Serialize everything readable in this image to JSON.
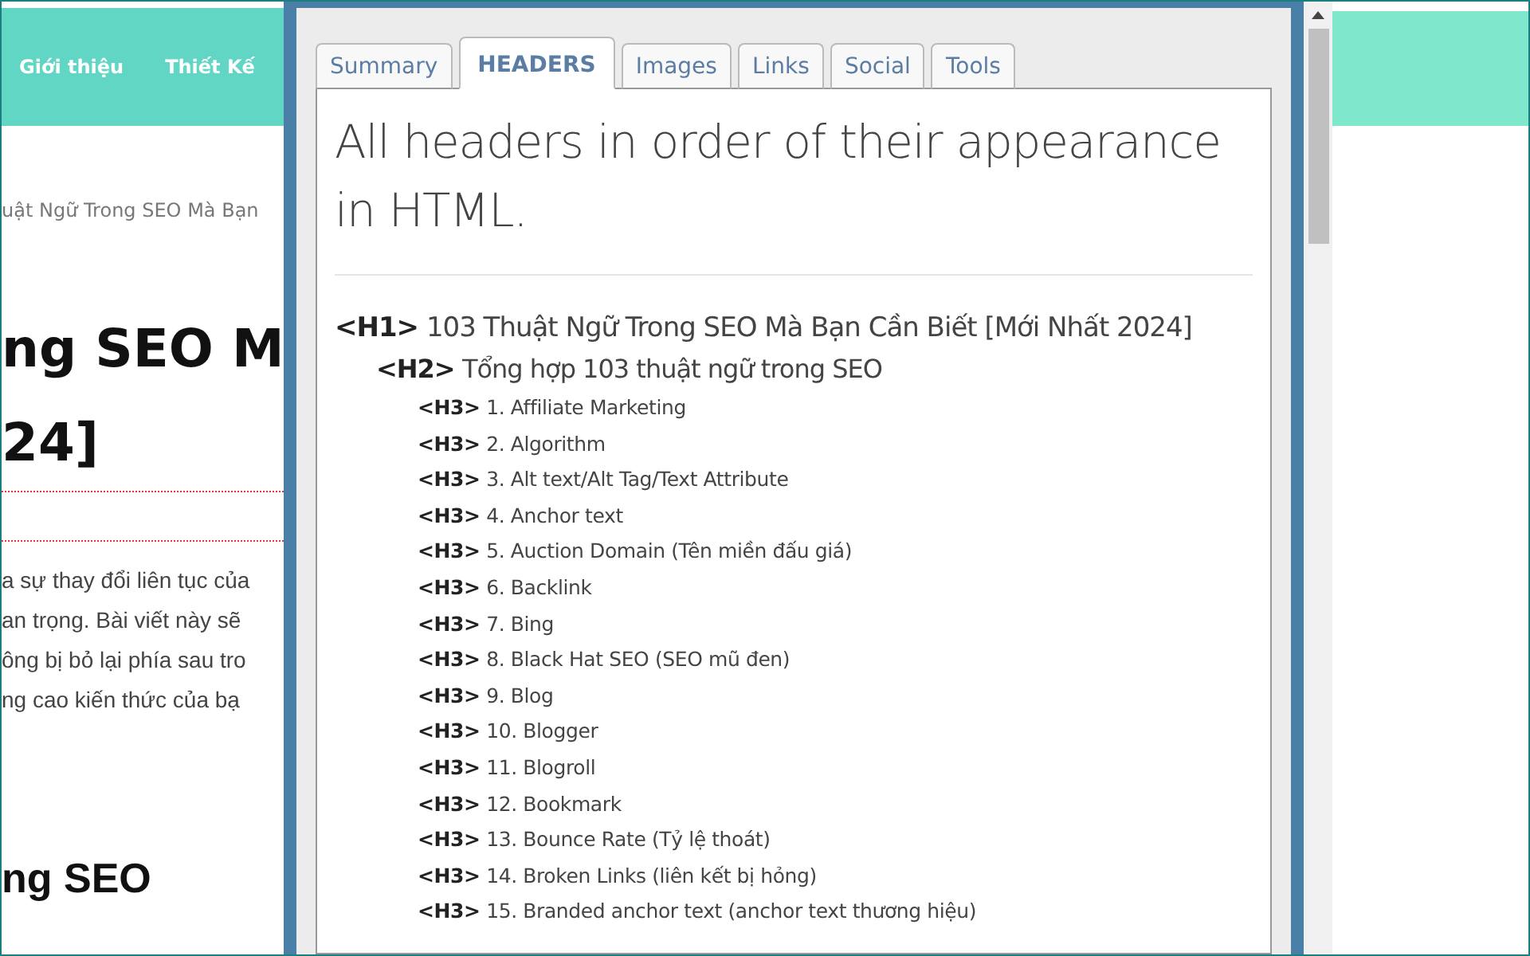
{
  "page": {
    "nav": [
      {
        "label": "Giới thiệu"
      },
      {
        "label": "Thiết Kế"
      }
    ],
    "breadcrumb": "uật Ngữ Trong SEO Mà Bạn",
    "title_lines": [
      "ng SEO M",
      "24]"
    ],
    "paragraph_lines": [
      "a sự thay đổi liên tục của",
      "an trọng. Bài viết này sẽ",
      "ông bị bỏ lại phía sau tro",
      "ng cao kiến thức của bạ"
    ],
    "subheading": "ng SEO"
  },
  "popup": {
    "tabs": [
      {
        "label": "Summary",
        "selected": false
      },
      {
        "label": "HEADERS",
        "selected": true
      },
      {
        "label": "Images",
        "selected": false
      },
      {
        "label": "Links",
        "selected": false
      },
      {
        "label": "Social",
        "selected": false
      },
      {
        "label": "Tools",
        "selected": false
      }
    ],
    "heading": "All headers in order of their appearance in HTML.",
    "headers": [
      {
        "tag": "<H1>",
        "text": "103 Thuật Ngữ Trong SEO Mà Bạn Cần Biết [Mới Nhất 2024]",
        "children": [
          {
            "tag": "<H2>",
            "text": "Tổng hợp 103 thuật ngữ trong SEO",
            "children": [
              {
                "tag": "<H3>",
                "text": "1. Affiliate Marketing"
              },
              {
                "tag": "<H3>",
                "text": "2. Algorithm"
              },
              {
                "tag": "<H3>",
                "text": "3. Alt text/Alt Tag/Text Attribute"
              },
              {
                "tag": "<H3>",
                "text": "4. Anchor text"
              },
              {
                "tag": "<H3>",
                "text": "5. Auction Domain (Tên miền đấu giá)"
              },
              {
                "tag": "<H3>",
                "text": "6. Backlink"
              },
              {
                "tag": "<H3>",
                "text": "7. Bing"
              },
              {
                "tag": "<H3>",
                "text": "8. Black Hat SEO (SEO mũ đen)"
              },
              {
                "tag": "<H3>",
                "text": "9. Blog"
              },
              {
                "tag": "<H3>",
                "text": "10. Blogger"
              },
              {
                "tag": "<H3>",
                "text": "11. Blogroll"
              },
              {
                "tag": "<H3>",
                "text": "12. Bookmark"
              },
              {
                "tag": "<H3>",
                "text": "13. Bounce Rate (Tỷ lệ thoát)"
              },
              {
                "tag": "<H3>",
                "text": "14. Broken Links (liên kết bị hỏng)"
              },
              {
                "tag": "<H3>",
                "text": "15. Branded anchor text (anchor text thương hiệu)"
              }
            ]
          }
        ]
      }
    ]
  }
}
